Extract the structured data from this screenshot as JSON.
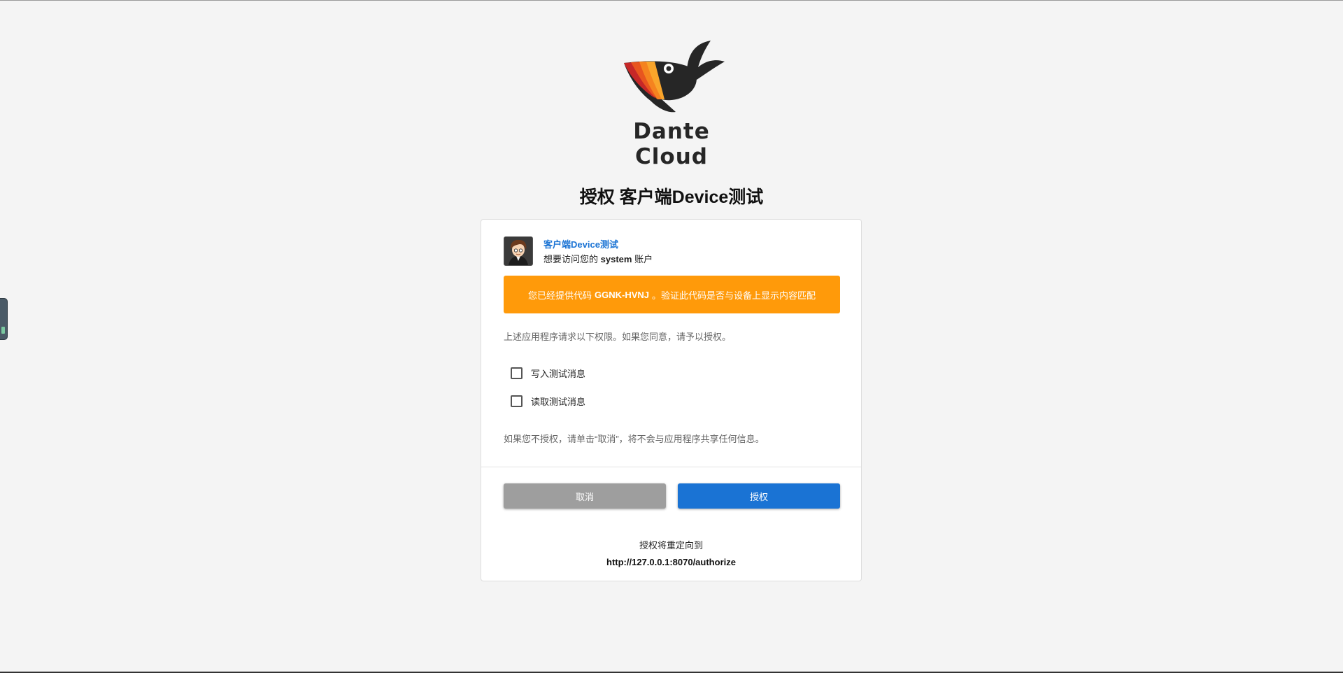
{
  "brand": {
    "name": "Dante Cloud"
  },
  "page": {
    "title": "授权 客户端Device测试"
  },
  "client": {
    "name": "客户端Device测试",
    "access_prefix": "想要访问您的",
    "account": "system",
    "access_suffix": "账户"
  },
  "alert": {
    "prefix": "您已经提供代码",
    "code": "GGNK-HVNJ",
    "suffix": "。验证此代码是否与设备上显示内容匹配"
  },
  "permissions": {
    "intro": "上述应用程序请求以下权限。如果您同意，请予以授权。",
    "items": [
      {
        "label": "写入测试消息",
        "checked": false
      },
      {
        "label": "读取测试消息",
        "checked": false
      }
    ]
  },
  "deny_note": "如果您不授权，请单击“取消”，将不会与应用程序共享任何信息。",
  "actions": {
    "cancel_label": "取消",
    "authorize_label": "授权"
  },
  "redirect": {
    "label": "授权将重定向到",
    "url": "http://127.0.0.1:8070/authorize"
  },
  "colors": {
    "primary": "#1a73d4",
    "warning": "#ff9a0a",
    "cancel": "#9e9e9e",
    "background": "#f4f4f4"
  },
  "icons": {
    "logo": "whale-logo-icon",
    "avatar": "user-avatar"
  }
}
